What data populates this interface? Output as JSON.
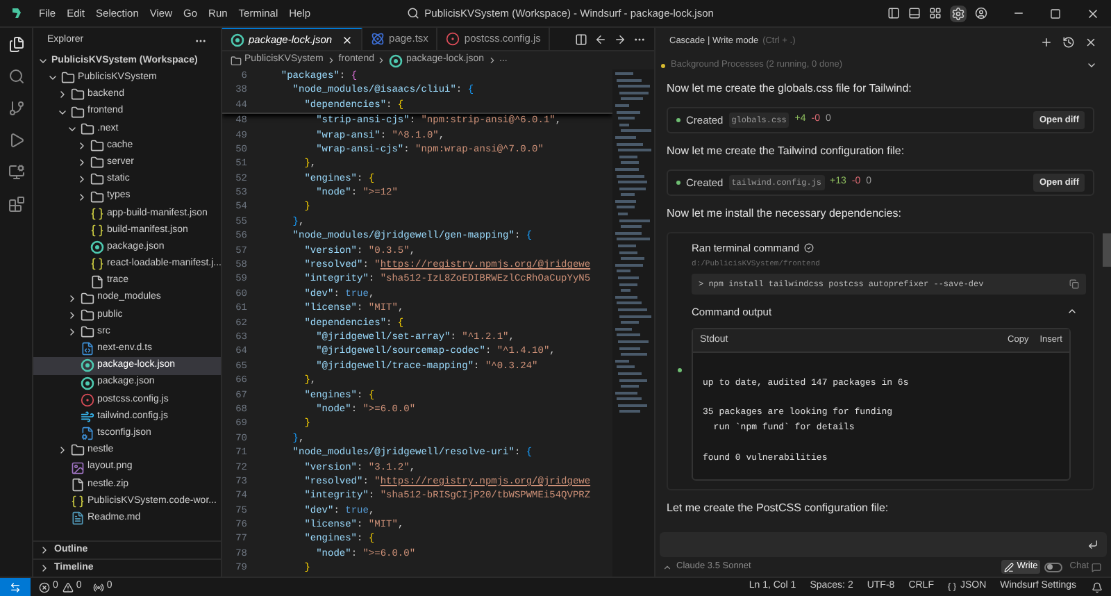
{
  "window": {
    "title": "PublicisKVSystem (Workspace) - Windsurf - package-lock.json",
    "menu": [
      "File",
      "Edit",
      "Selection",
      "View",
      "Go",
      "Run",
      "Terminal",
      "Help"
    ]
  },
  "explorer": {
    "title": "Explorer",
    "tree": [
      {
        "label": "PublicisKVSystem (Workspace)",
        "kind": "workspace",
        "expanded": true,
        "selected": false,
        "children": [
          {
            "label": "PublicisKVSystem",
            "kind": "folder",
            "expanded": true,
            "selected": false,
            "children": [
              {
                "label": "backend",
                "kind": "folder",
                "expanded": false,
                "selected": false
              },
              {
                "label": "frontend",
                "kind": "folder",
                "expanded": true,
                "selected": false,
                "children": [
                  {
                    "label": ".next",
                    "kind": "folder",
                    "expanded": true,
                    "selected": false,
                    "children": [
                      {
                        "label": "cache",
                        "kind": "folder",
                        "expanded": false,
                        "selected": false
                      },
                      {
                        "label": "server",
                        "kind": "folder",
                        "expanded": false,
                        "selected": false
                      },
                      {
                        "label": "static",
                        "kind": "folder",
                        "expanded": false,
                        "selected": false
                      },
                      {
                        "label": "types",
                        "kind": "folder",
                        "expanded": false,
                        "selected": false
                      },
                      {
                        "label": "app-build-manifest.json",
                        "kind": "json",
                        "selected": false
                      },
                      {
                        "label": "build-manifest.json",
                        "kind": "json",
                        "selected": false
                      },
                      {
                        "label": "package.json",
                        "kind": "npm",
                        "selected": false
                      },
                      {
                        "label": "react-loadable-manifest.j...",
                        "kind": "json",
                        "selected": false
                      },
                      {
                        "label": "trace",
                        "kind": "file",
                        "selected": false
                      }
                    ]
                  },
                  {
                    "label": "node_modules",
                    "kind": "folder",
                    "expanded": false,
                    "selected": false
                  },
                  {
                    "label": "public",
                    "kind": "folder",
                    "expanded": false,
                    "selected": false
                  },
                  {
                    "label": "src",
                    "kind": "folder",
                    "expanded": false,
                    "selected": false
                  },
                  {
                    "label": "next-env.d.ts",
                    "kind": "ts",
                    "selected": false
                  },
                  {
                    "label": "package-lock.json",
                    "kind": "npm",
                    "selected": true
                  },
                  {
                    "label": "package.json",
                    "kind": "npm",
                    "selected": false
                  },
                  {
                    "label": "postcss.config.js",
                    "kind": "postcss",
                    "selected": false
                  },
                  {
                    "label": "tailwind.config.js",
                    "kind": "tailwind",
                    "selected": false
                  },
                  {
                    "label": "tsconfig.json",
                    "kind": "tsconfig",
                    "selected": false
                  }
                ]
              },
              {
                "label": "nestle",
                "kind": "folder",
                "expanded": false,
                "selected": false
              },
              {
                "label": "layout.png",
                "kind": "image",
                "selected": false
              },
              {
                "label": "nestle.zip",
                "kind": "file",
                "selected": false
              },
              {
                "label": "PublicisKVSystem.code-wor...",
                "kind": "json",
                "selected": false
              },
              {
                "label": "Readme.md",
                "kind": "md",
                "selected": false
              }
            ]
          }
        ]
      }
    ],
    "panels": [
      {
        "label": "Outline",
        "expanded": false
      },
      {
        "label": "Timeline",
        "expanded": false
      }
    ]
  },
  "editor": {
    "tabs": [
      {
        "label": "package-lock.json",
        "kind": "npm",
        "selected": true,
        "preview": true
      },
      {
        "label": "page.tsx",
        "kind": "react",
        "selected": false,
        "preview": false
      },
      {
        "label": "postcss.config.js",
        "kind": "postcss",
        "selected": false,
        "preview": false
      }
    ],
    "breadcrumb": [
      "PublicisKVSystem",
      "frontend",
      "package-lock.json",
      "..."
    ],
    "sticky_lines": [
      {
        "num": "6",
        "tokens": [
          {
            "kind": "key",
            "text": "  \"packages\""
          },
          {
            "kind": "punct",
            "text": ": "
          },
          {
            "kind": "brace",
            "text": "{",
            "color": "#da70d6"
          }
        ]
      },
      {
        "num": "38",
        "tokens": [
          {
            "kind": "key",
            "text": "    \"node_modules/@isaacs/cliui\""
          },
          {
            "kind": "punct",
            "text": ": "
          },
          {
            "kind": "brace",
            "text": "{",
            "color": "#179fff"
          }
        ]
      },
      {
        "num": "44",
        "tokens": [
          {
            "kind": "key",
            "text": "      \"dependencies\""
          },
          {
            "kind": "punct",
            "text": ": "
          },
          {
            "kind": "brace",
            "text": "{",
            "color": "#ffd700"
          }
        ]
      }
    ],
    "lines": [
      {
        "num": "48",
        "tokens": [
          {
            "kind": "key",
            "text": "        \"strip-ansi-cjs\""
          },
          {
            "kind": "punct",
            "text": ": "
          },
          {
            "kind": "str",
            "text": "\"npm:strip-ansi@^6.0.1\""
          },
          {
            "kind": "punct",
            "text": ","
          }
        ]
      },
      {
        "num": "49",
        "tokens": [
          {
            "kind": "key",
            "text": "        \"wrap-ansi\""
          },
          {
            "kind": "punct",
            "text": ": "
          },
          {
            "kind": "str",
            "text": "\"^8.1.0\""
          },
          {
            "kind": "punct",
            "text": ","
          }
        ]
      },
      {
        "num": "50",
        "tokens": [
          {
            "kind": "key",
            "text": "        \"wrap-ansi-cjs\""
          },
          {
            "kind": "punct",
            "text": ": "
          },
          {
            "kind": "str",
            "text": "\"npm:wrap-ansi@^7.0.0\""
          }
        ]
      },
      {
        "num": "51",
        "tokens": [
          {
            "kind": "brace",
            "text": "      }",
            "color": "#ffd700"
          },
          {
            "kind": "punct",
            "text": ","
          }
        ]
      },
      {
        "num": "52",
        "tokens": [
          {
            "kind": "key",
            "text": "      \"engines\""
          },
          {
            "kind": "punct",
            "text": ": "
          },
          {
            "kind": "brace",
            "text": "{",
            "color": "#ffd700"
          }
        ]
      },
      {
        "num": "53",
        "tokens": [
          {
            "kind": "key",
            "text": "        \"node\""
          },
          {
            "kind": "punct",
            "text": ": "
          },
          {
            "kind": "str",
            "text": "\">=12\""
          }
        ]
      },
      {
        "num": "54",
        "tokens": [
          {
            "kind": "brace",
            "text": "      }",
            "color": "#ffd700"
          }
        ]
      },
      {
        "num": "55",
        "tokens": [
          {
            "kind": "brace",
            "text": "    }",
            "color": "#179fff"
          },
          {
            "kind": "punct",
            "text": ","
          }
        ]
      },
      {
        "num": "56",
        "tokens": [
          {
            "kind": "key",
            "text": "    \"node_modules/@jridgewell/gen-mapping\""
          },
          {
            "kind": "punct",
            "text": ": "
          },
          {
            "kind": "brace",
            "text": "{",
            "color": "#179fff"
          }
        ]
      },
      {
        "num": "57",
        "tokens": [
          {
            "kind": "key",
            "text": "      \"version\""
          },
          {
            "kind": "punct",
            "text": ": "
          },
          {
            "kind": "str",
            "text": "\"0.3.5\""
          },
          {
            "kind": "punct",
            "text": ","
          }
        ]
      },
      {
        "num": "58",
        "tokens": [
          {
            "kind": "key",
            "text": "      \"resolved\""
          },
          {
            "kind": "punct",
            "text": ": "
          },
          {
            "kind": "str",
            "text": "\""
          },
          {
            "kind": "link",
            "text": "https://registry.npmjs.org/@jridgewe"
          }
        ]
      },
      {
        "num": "59",
        "tokens": [
          {
            "kind": "key",
            "text": "      \"integrity\""
          },
          {
            "kind": "punct",
            "text": ": "
          },
          {
            "kind": "str",
            "text": "\"sha512-IzL8ZoEDIBRWEzlCcRhOaCupYyN5"
          }
        ]
      },
      {
        "num": "60",
        "tokens": [
          {
            "kind": "key",
            "text": "      \"dev\""
          },
          {
            "kind": "punct",
            "text": ": "
          },
          {
            "kind": "bool",
            "text": "true"
          },
          {
            "kind": "punct",
            "text": ","
          }
        ]
      },
      {
        "num": "61",
        "tokens": [
          {
            "kind": "key",
            "text": "      \"license\""
          },
          {
            "kind": "punct",
            "text": ": "
          },
          {
            "kind": "str",
            "text": "\"MIT\""
          },
          {
            "kind": "punct",
            "text": ","
          }
        ]
      },
      {
        "num": "62",
        "tokens": [
          {
            "kind": "key",
            "text": "      \"dependencies\""
          },
          {
            "kind": "punct",
            "text": ": "
          },
          {
            "kind": "brace",
            "text": "{",
            "color": "#ffd700"
          }
        ]
      },
      {
        "num": "63",
        "tokens": [
          {
            "kind": "key",
            "text": "        \"@jridgewell/set-array\""
          },
          {
            "kind": "punct",
            "text": ": "
          },
          {
            "kind": "str",
            "text": "\"^1.2.1\""
          },
          {
            "kind": "punct",
            "text": ","
          }
        ]
      },
      {
        "num": "64",
        "tokens": [
          {
            "kind": "key",
            "text": "        \"@jridgewell/sourcemap-codec\""
          },
          {
            "kind": "punct",
            "text": ": "
          },
          {
            "kind": "str",
            "text": "\"^1.4.10\""
          },
          {
            "kind": "punct",
            "text": ","
          }
        ]
      },
      {
        "num": "65",
        "tokens": [
          {
            "kind": "key",
            "text": "        \"@jridgewell/trace-mapping\""
          },
          {
            "kind": "punct",
            "text": ": "
          },
          {
            "kind": "str",
            "text": "\"^0.3.24\""
          }
        ]
      },
      {
        "num": "66",
        "tokens": [
          {
            "kind": "brace",
            "text": "      }",
            "color": "#ffd700"
          },
          {
            "kind": "punct",
            "text": ","
          }
        ]
      },
      {
        "num": "67",
        "tokens": [
          {
            "kind": "key",
            "text": "      \"engines\""
          },
          {
            "kind": "punct",
            "text": ": "
          },
          {
            "kind": "brace",
            "text": "{",
            "color": "#ffd700"
          }
        ]
      },
      {
        "num": "68",
        "tokens": [
          {
            "kind": "key",
            "text": "        \"node\""
          },
          {
            "kind": "punct",
            "text": ": "
          },
          {
            "kind": "str",
            "text": "\">=6.0.0\""
          }
        ]
      },
      {
        "num": "69",
        "tokens": [
          {
            "kind": "brace",
            "text": "      }",
            "color": "#ffd700"
          }
        ]
      },
      {
        "num": "70",
        "tokens": [
          {
            "kind": "brace",
            "text": "    }",
            "color": "#179fff"
          },
          {
            "kind": "punct",
            "text": ","
          }
        ]
      },
      {
        "num": "71",
        "tokens": [
          {
            "kind": "key",
            "text": "    \"node_modules/@jridgewell/resolve-uri\""
          },
          {
            "kind": "punct",
            "text": ": "
          },
          {
            "kind": "brace",
            "text": "{",
            "color": "#179fff"
          }
        ]
      },
      {
        "num": "72",
        "tokens": [
          {
            "kind": "key",
            "text": "      \"version\""
          },
          {
            "kind": "punct",
            "text": ": "
          },
          {
            "kind": "str",
            "text": "\"3.1.2\""
          },
          {
            "kind": "punct",
            "text": ","
          }
        ]
      },
      {
        "num": "73",
        "tokens": [
          {
            "kind": "key",
            "text": "      \"resolved\""
          },
          {
            "kind": "punct",
            "text": ": "
          },
          {
            "kind": "str",
            "text": "\""
          },
          {
            "kind": "link",
            "text": "https://registry.npmjs.org/@jridgewe"
          }
        ]
      },
      {
        "num": "74",
        "tokens": [
          {
            "kind": "key",
            "text": "      \"integrity\""
          },
          {
            "kind": "punct",
            "text": ": "
          },
          {
            "kind": "str",
            "text": "\"sha512-bRISgCIjP20/tbWSPWMEi54QVPRZ"
          }
        ]
      },
      {
        "num": "75",
        "tokens": [
          {
            "kind": "key",
            "text": "      \"dev\""
          },
          {
            "kind": "punct",
            "text": ": "
          },
          {
            "kind": "bool",
            "text": "true"
          },
          {
            "kind": "punct",
            "text": ","
          }
        ]
      },
      {
        "num": "76",
        "tokens": [
          {
            "kind": "key",
            "text": "      \"license\""
          },
          {
            "kind": "punct",
            "text": ": "
          },
          {
            "kind": "str",
            "text": "\"MIT\""
          },
          {
            "kind": "punct",
            "text": ","
          }
        ]
      },
      {
        "num": "77",
        "tokens": [
          {
            "kind": "key",
            "text": "      \"engines\""
          },
          {
            "kind": "punct",
            "text": ": "
          },
          {
            "kind": "brace",
            "text": "{",
            "color": "#ffd700"
          }
        ]
      },
      {
        "num": "78",
        "tokens": [
          {
            "kind": "key",
            "text": "        \"node\""
          },
          {
            "kind": "punct",
            "text": ": "
          },
          {
            "kind": "str",
            "text": "\">=6.0.0\""
          }
        ]
      },
      {
        "num": "79",
        "tokens": [
          {
            "kind": "brace",
            "text": "      }",
            "color": "#ffd700"
          }
        ]
      }
    ]
  },
  "cascade": {
    "title": "Cascade | Write mode",
    "shortcut": "(Ctrl + .)",
    "background": "Background Processes (2 running, 0 done)",
    "messages": [
      {
        "kind": "text",
        "text": "Now let me create the globals.css file for Tailwind:"
      },
      {
        "kind": "file",
        "status": "Created",
        "file": "globals.css",
        "added": "+4",
        "removed": "-0",
        "count": "0",
        "button": "Open diff"
      },
      {
        "kind": "text",
        "text": "Now let me create the Tailwind configuration file:"
      },
      {
        "kind": "file",
        "status": "Created",
        "file": "tailwind.config.js",
        "added": "+13",
        "removed": "-0",
        "count": "0",
        "button": "Open diff"
      },
      {
        "kind": "text",
        "text": "Now let me install the necessary dependencies:"
      },
      {
        "kind": "command",
        "title": "Ran terminal command",
        "cwd": "d:/PublicisKVSystem/frontend",
        "command": "> npm install tailwindcss postcss autoprefixer --save-dev",
        "output_label": "Command output",
        "expanded": true,
        "stream": "Stdout",
        "actions": [
          "Copy",
          "Insert"
        ],
        "output": "up to date, audited 147 packages in 6s\n\n35 packages are looking for funding\n  run `npm fund` for details\n\nfound 0 vulnerabilities"
      },
      {
        "kind": "text",
        "text": "Let me create the PostCSS configuration file:"
      }
    ],
    "model": "Claude 3.5 Sonnet",
    "modes": [
      {
        "label": "Write",
        "selected": true
      },
      {
        "label": "Chat",
        "selected": false
      }
    ]
  },
  "status_bar": {
    "errors": "0",
    "warnings": "0",
    "ports": "0",
    "items": [
      {
        "kind": "text",
        "text": "Ln 1, Col 1"
      },
      {
        "kind": "text",
        "text": "Spaces: 2"
      },
      {
        "kind": "text",
        "text": "UTF-8"
      },
      {
        "kind": "text",
        "text": "CRLF"
      },
      {
        "kind": "language",
        "text": "JSON"
      },
      {
        "kind": "text",
        "text": "Windsurf Settings"
      }
    ]
  }
}
